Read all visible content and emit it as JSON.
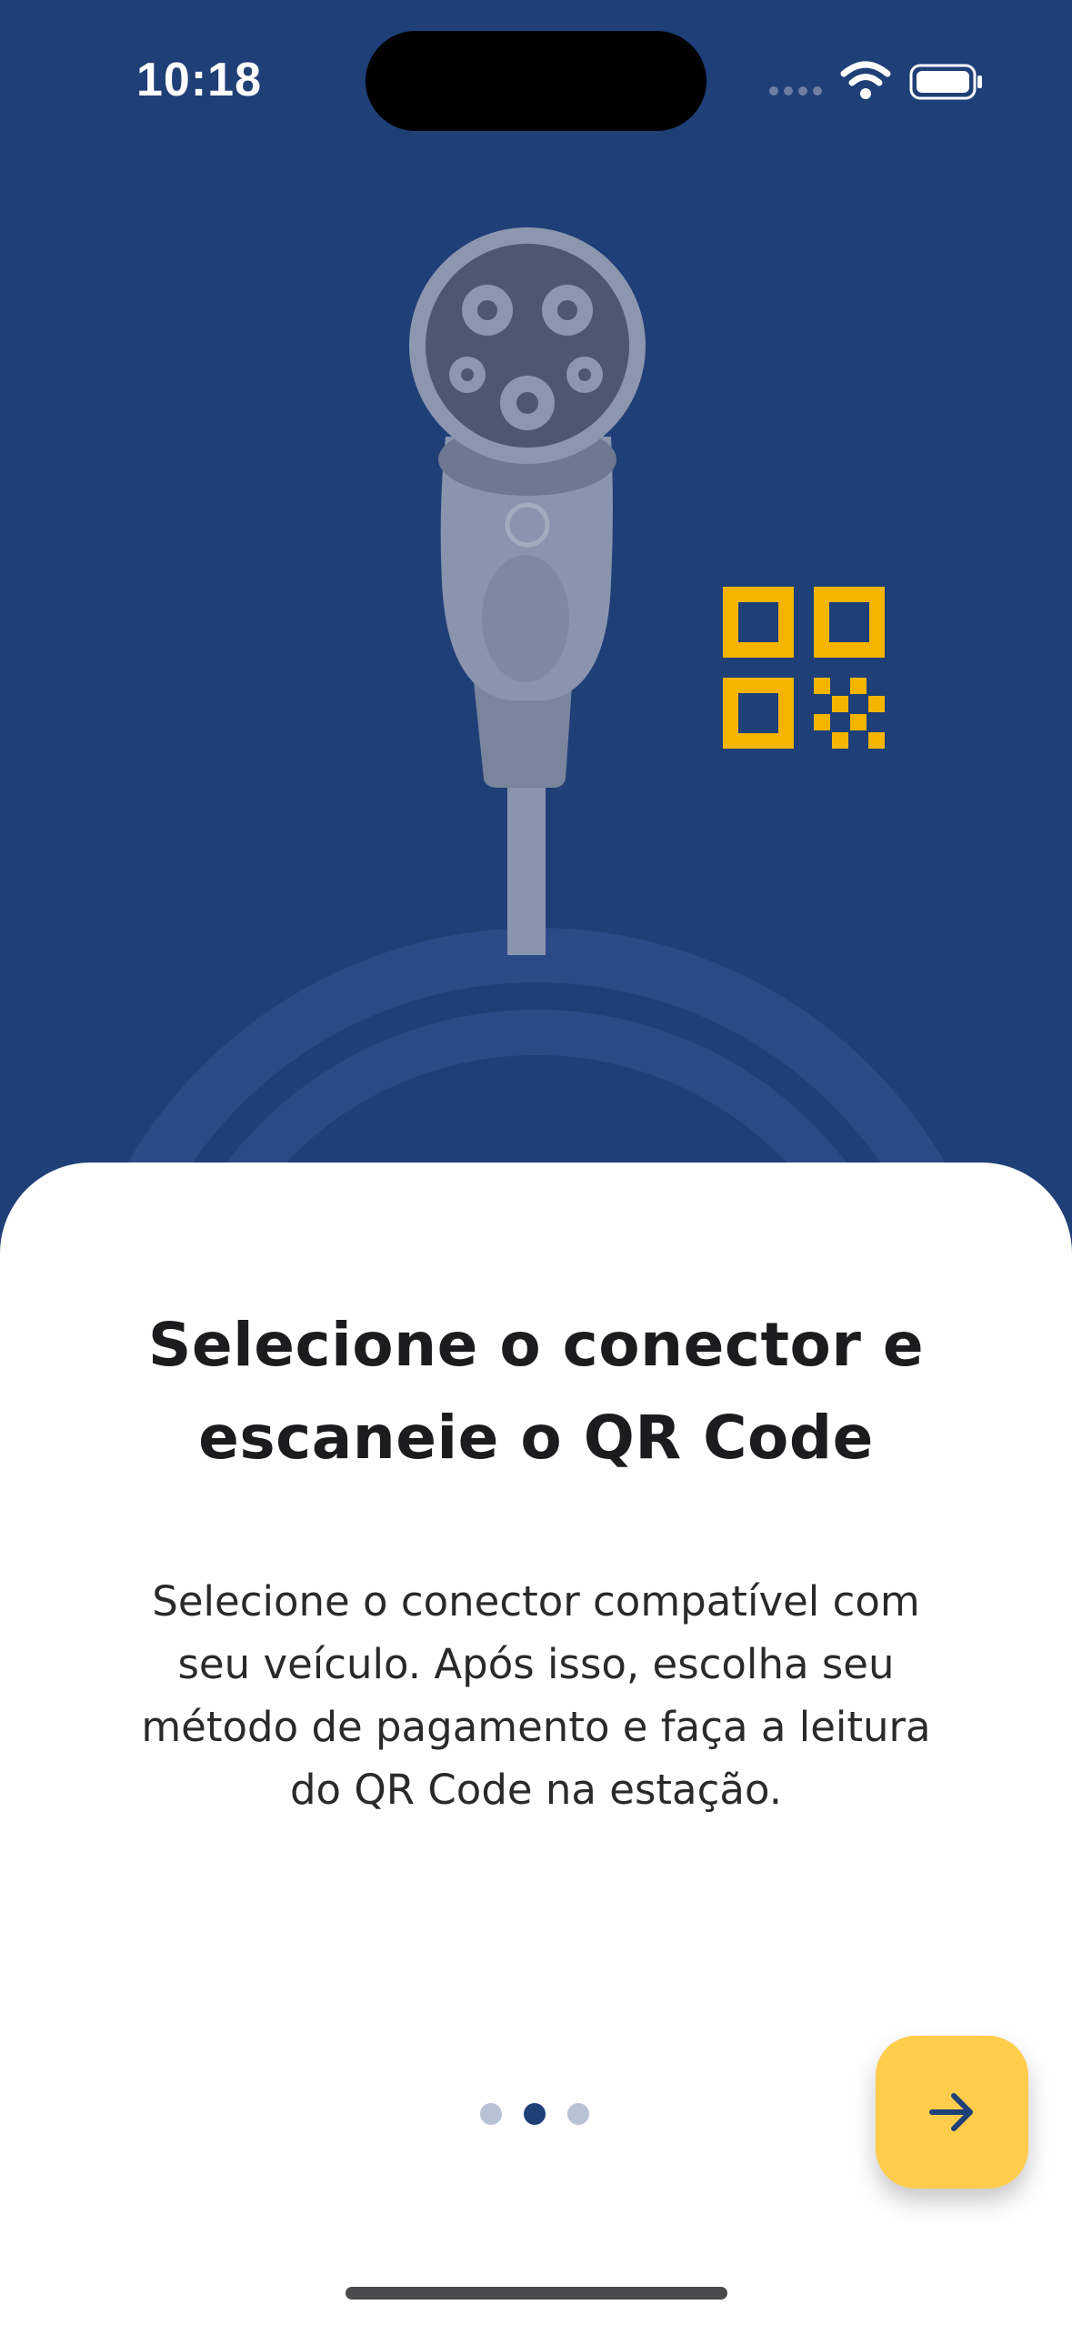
{
  "status_bar": {
    "time": "10:18"
  },
  "onboarding": {
    "title": "Selecione o conector e escaneie o QR Code",
    "description": "Selecione o conector compatível com seu veículo. Após isso, escolha seu método de pagamento e faça a leitura do QR Code na estação.",
    "page_indicator": {
      "total": 3,
      "current": 2
    }
  },
  "colors": {
    "hero_background": "#1F3F77",
    "accent": "#FFCD4B",
    "qr_icon": "#F5B400",
    "connector": "#8B94AE"
  },
  "icons": {
    "next": "arrow-right-icon",
    "qr": "qr-code-icon",
    "connector": "ev-connector-icon"
  }
}
